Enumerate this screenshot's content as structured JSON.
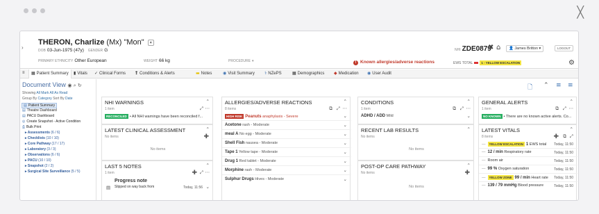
{
  "header": {
    "surname": "THERON, Charlize",
    "suffix": "(Mx) \"Mon\"",
    "dob_label": "DOB",
    "dob": "03-Jun-1975 (47y)",
    "gender_label": "GENDER",
    "gender": "G",
    "ethnicity_label": "PRIMARY ETHNICITY",
    "ethnicity": "Other European",
    "weight_label": "WEIGHT",
    "weight": "66 kg",
    "procedure_label": "PROCEDURE",
    "allergy_warning": "Known allergies/adverse reactions",
    "ews_label": "EWS TOTAL",
    "ews_tag": "1 - YELLOW ESCALATION",
    "mrn_label": "NHI",
    "mrn": "ZDE0879",
    "user": "James Britton",
    "logout": "LOGOUT"
  },
  "tabs": [
    {
      "label": "Patient Summary",
      "icon": "grid-icon"
    },
    {
      "label": "Vitals",
      "icon": "chart-icon"
    },
    {
      "label": "Clinical Forms",
      "icon": "form-icon"
    },
    {
      "label": "Conditions & Alerts",
      "icon": "alert-icon"
    },
    {
      "label": "Notes",
      "icon": "note-icon"
    },
    {
      "label": "Visit Summary",
      "icon": "visit-icon"
    },
    {
      "label": "NZePS",
      "icon": "pill-icon"
    },
    {
      "label": "Demographics",
      "icon": "person-icon"
    },
    {
      "label": "Medication",
      "icon": "medication-icon"
    },
    {
      "label": "User Audit",
      "icon": "audit-icon"
    }
  ],
  "sidebar": {
    "title": "Document View",
    "showing": "Showing",
    "all": "All",
    "mark_all": "Mark All As Read",
    "group_by": "Group By",
    "category": "Category",
    "sort_by": "Sort By",
    "date": "Date",
    "items": [
      {
        "label": "Patient Summary",
        "selected": true
      },
      {
        "label": "Theatre Dashboard"
      },
      {
        "label": "PACU Dashboard"
      },
      {
        "label": "Create Snapshot - Active Condition"
      },
      {
        "label": "Bulk Print"
      }
    ],
    "groups": [
      {
        "label": "Assessments",
        "count": "(6 / 6)"
      },
      {
        "label": "Checklists",
        "count": "(10 / 10)"
      },
      {
        "label": "Core Pathway",
        "count": "(17 / 17)"
      },
      {
        "label": "Laboratory",
        "count": "(3 / 3)"
      },
      {
        "label": "Observations",
        "count": "(6 / 6)"
      },
      {
        "label": "PACU",
        "count": "(10 / 10)"
      },
      {
        "label": "Snapshot",
        "count": "(2 / 2)"
      },
      {
        "label": "Surgical Site Surveillance",
        "count": "(5 / 5)"
      }
    ]
  },
  "panels": {
    "nhi": {
      "title": "NHI WARNINGS",
      "count": "1 item",
      "badge": "RECONCILED",
      "text": "All NHI warnings have been reconciled f..."
    },
    "assessment": {
      "title": "LATEST CLINICAL ASSESSMENT",
      "count": "No items",
      "empty": "No items"
    },
    "notes": {
      "title": "LAST 5 NOTES",
      "count": "1 item",
      "note_title": "Progress note",
      "note_text": "Slipped on way back from",
      "note_time": "Today, 11:56"
    },
    "allergies": {
      "title": "ALLERGIES/ADVERSE REACTIONS",
      "count": "8 items",
      "items": [
        {
          "badge": "HIGH RISK",
          "name": "Peanuts",
          "detail": "anaphylaxis - Severe"
        },
        {
          "name": "Acetone",
          "detail": "rash - Moderate"
        },
        {
          "name": "meal A",
          "detail": "No egg - Moderate"
        },
        {
          "name": "Shell Fish",
          "detail": "nausea - Moderate"
        },
        {
          "name": "Tape 1",
          "detail": "Yellow tape - Moderate"
        },
        {
          "name": "Drug 1",
          "detail": "Red tablet - Moderate"
        },
        {
          "name": "Morphine",
          "detail": "rash - Moderate"
        },
        {
          "name": "Sulphur Drugs",
          "detail": "Hives - Moderate"
        }
      ]
    },
    "conditions": {
      "title": "CONDITIONS",
      "count": "1 item",
      "item_name": "ADHD / ADD",
      "item_detail": "Mild"
    },
    "labs": {
      "title": "RECENT LAB RESULTS",
      "count": "No items",
      "empty": "No items"
    },
    "postop": {
      "title": "POST-OP CARE PATHWAY",
      "count": "No items",
      "empty": "No items"
    },
    "alerts": {
      "title": "GENERAL ALERTS",
      "count": "1 item",
      "badge": "NO KNOWN",
      "text": "There are no known active alerts. Co..."
    },
    "vitals": {
      "title": "LATEST VITALS",
      "count": "8 items",
      "items": [
        {
          "tag": "YELLOW ESCALATION",
          "value": "1",
          "label": "EWS total",
          "time": "Today, 11:50"
        },
        {
          "value": "12 / min",
          "label": "Respiratory rate",
          "time": "Today, 11:50"
        },
        {
          "value": "",
          "label": "Room air",
          "time": "Today, 11:50"
        },
        {
          "value": "99 %",
          "label": "Oxygen saturation",
          "time": "Today, 11:50"
        },
        {
          "tag": "YELLOW ZONE",
          "value": "99 / min",
          "label": "Heart rate",
          "time": "Today, 11:50"
        },
        {
          "value": "139 / 79 mmHg",
          "label": "Blood pressure",
          "time": "Today, 11:50"
        }
      ]
    }
  },
  "colors": {
    "accent": "#3a6fb0",
    "danger": "#c0392b",
    "success": "#27ae60",
    "yellow": "#f5e642"
  }
}
